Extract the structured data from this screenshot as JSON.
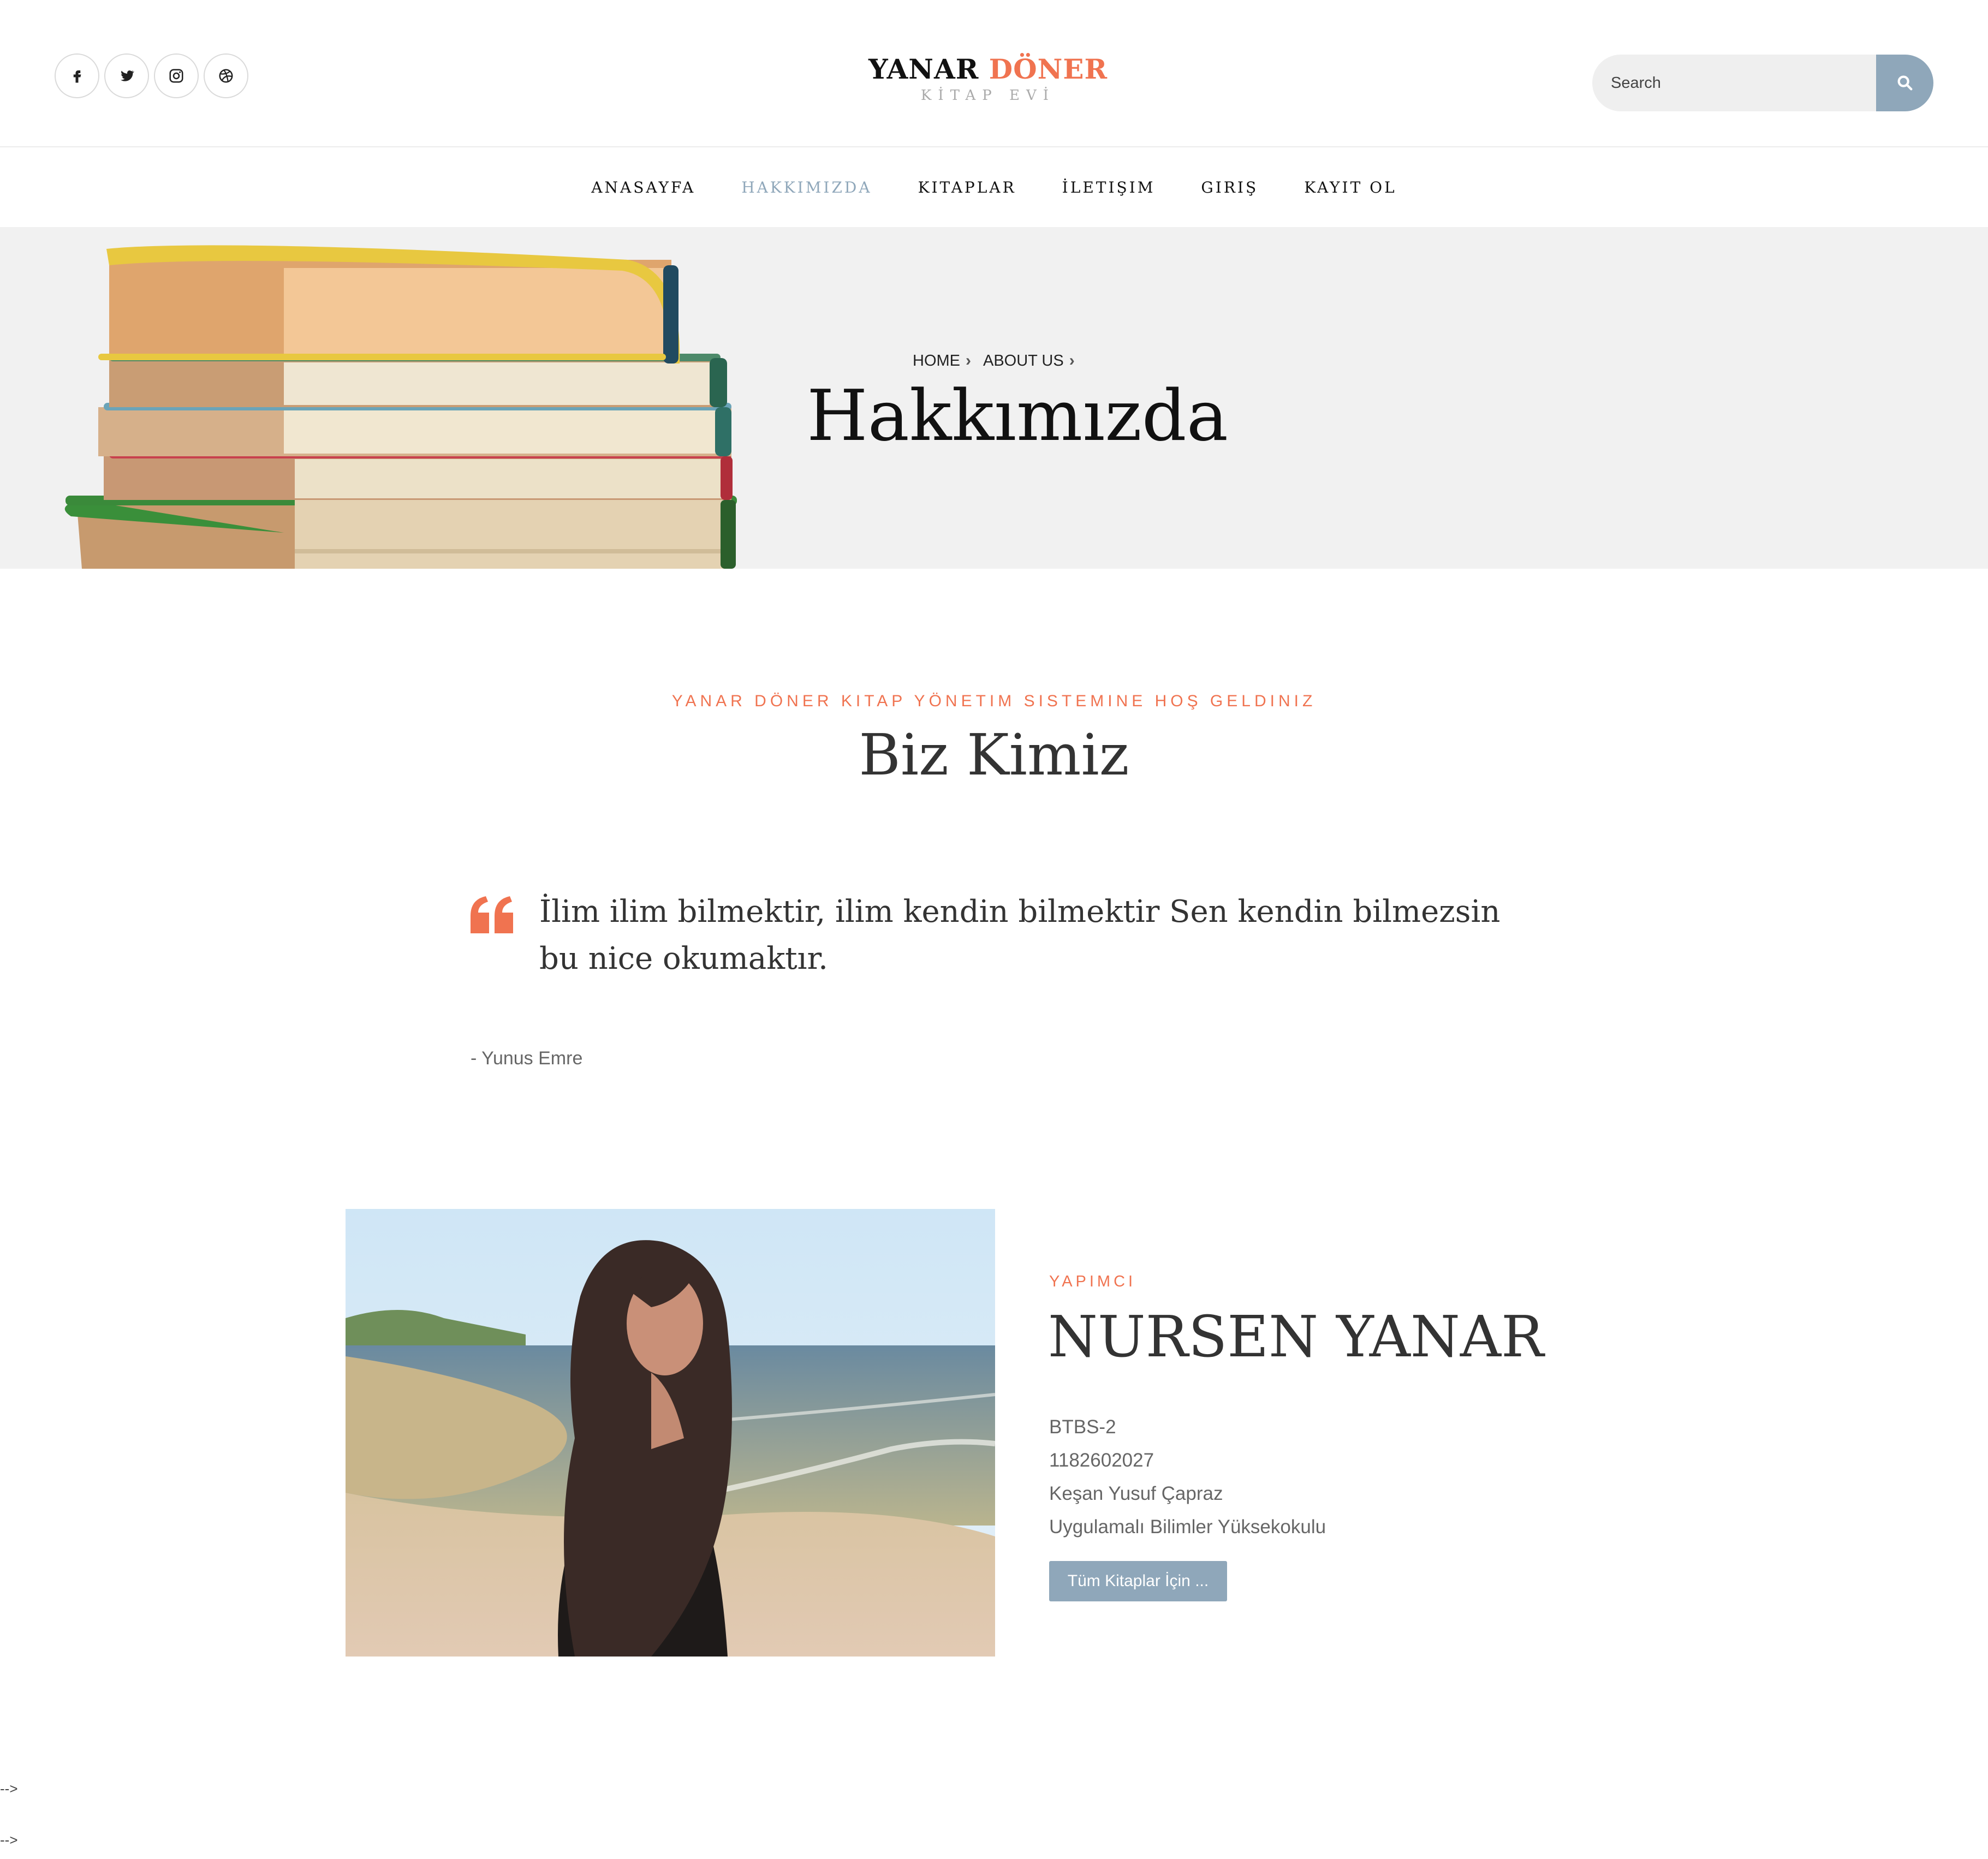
{
  "header": {
    "social": [
      "facebook-icon",
      "twitter-icon",
      "instagram-icon",
      "dribbble-icon"
    ],
    "logo": {
      "main_dark": "YANAR",
      "main_accent": "DÖNER",
      "sub": "KİTAP EVİ"
    },
    "search": {
      "placeholder": "Search"
    }
  },
  "nav": {
    "items": [
      "ANASAYFA",
      "HAKKIMIZDA",
      "KITAPLAR",
      "İLETIŞIM",
      "GIRIŞ",
      "KAYIT OL"
    ],
    "active_index": 1
  },
  "hero": {
    "breadcrumb": [
      "HOME",
      "ABOUT US"
    ],
    "title": "Hakkımızda"
  },
  "intro": {
    "kicker": "YANAR DÖNER KITAP YÖNETIM SISTEMINE HOŞ GELDINIZ",
    "title": "Biz Kimiz",
    "quote": "İlim ilim bilmektir, ilim kendin bilmektir Sen kendin bilmezsin bu nice okumaktır.",
    "author": "- Yunus Emre"
  },
  "profile": {
    "role": "YAPIMCI",
    "name": "NURSEN YANAR",
    "info": [
      "BTBS-2",
      "1182602027",
      "Keşan Yusuf Çapraz",
      "Uygulamalı Bilimler Yüksekokulu"
    ],
    "button": "Tüm Kitaplar İçin ..."
  },
  "footer_artifacts": [
    "-->",
    "-->"
  ],
  "colors": {
    "accent": "#f07350",
    "muted_blue": "#8fa7ba",
    "text": "#333333"
  }
}
